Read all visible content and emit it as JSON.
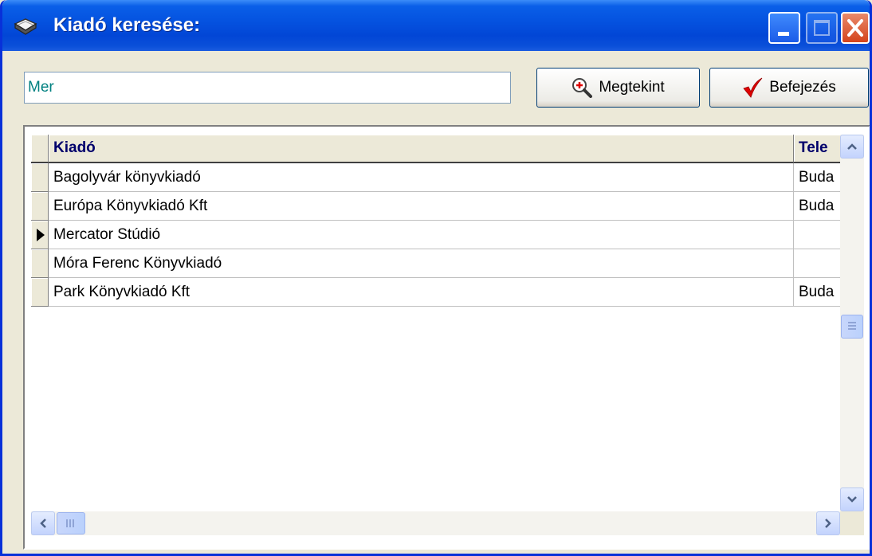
{
  "window": {
    "title": "Kiadó keresése:",
    "title_color": "#FFFFFF",
    "titlebar_color": "#0553E0"
  },
  "search": {
    "value": "Mer"
  },
  "buttons": {
    "view_label": "Megtekint",
    "finish_label": "Befejezés"
  },
  "grid": {
    "columns": [
      "Kiadó",
      "Tele"
    ],
    "rows": [
      {
        "kiado": "Bagolyvár könyvkiadó",
        "tele": "Buda",
        "current": false
      },
      {
        "kiado": "Európa Könyvkiadó Kft",
        "tele": "Buda",
        "current": false
      },
      {
        "kiado": "Mercator Stúdió",
        "tele": "",
        "current": true
      },
      {
        "kiado": "Móra Ferenc Könyvkiadó",
        "tele": "",
        "current": false
      },
      {
        "kiado": "Park Könyvkiadó Kft",
        "tele": "Buda",
        "current": false
      }
    ],
    "header_text_color": "#00006B"
  },
  "icons": {
    "app": "book-icon",
    "view": "magnifier-icon",
    "finish": "checkmark-icon",
    "minimize": "minimize-icon",
    "maximize": "maximize-icon",
    "close": "close-icon"
  }
}
